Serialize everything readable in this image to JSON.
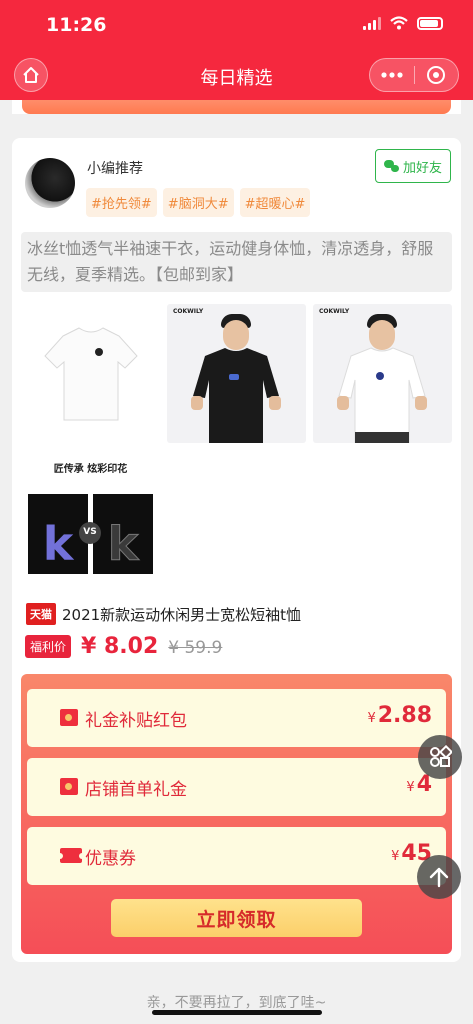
{
  "status_bar": {
    "time": "11:26"
  },
  "nav": {
    "title": "每日精选"
  },
  "post": {
    "author": "小编推荐",
    "add_friend_label": "加好友",
    "tags": [
      "#抢先领#",
      "#脑洞大#",
      "#超暖心#"
    ],
    "description": "冰丝t恤透气半袖速干衣，运动健身体恤，清凉透身，舒服无线，夏季精选。【包邮到家】",
    "images": [
      {
        "icon": "white-tshirt-image"
      },
      {
        "icon": "model-black-tshirt-image",
        "brand": "COKWILY"
      },
      {
        "icon": "model-white-tshirt-image",
        "brand": "COKWILY"
      },
      {
        "icon": "print-comparison-image",
        "caption": "匠传承 炫彩印花",
        "vs": "VS"
      }
    ]
  },
  "product": {
    "badge": "天猫",
    "title": "2021新款运动休闲男士宽松短袖t恤",
    "price_tag": "福利价",
    "price": "¥ 8.02",
    "original_price": "¥ 59.9"
  },
  "coupons": [
    {
      "label": "礼金补贴红包",
      "currency": "¥",
      "amount": "2.88",
      "icon": "red-envelope-icon"
    },
    {
      "label": "店铺首单礼金",
      "currency": "¥",
      "amount": "4",
      "icon": "red-envelope-icon"
    },
    {
      "label": "优惠券",
      "currency": "¥",
      "amount": "45",
      "icon": "coupon-ticket-icon"
    }
  ],
  "claim_button": "立即领取",
  "footer_text": "亲，不要再拉了，到底了哇~",
  "colors": {
    "primary_red": "#f5283e",
    "coupon_text": "#e02a3a",
    "friend_green": "#2fb54b"
  }
}
